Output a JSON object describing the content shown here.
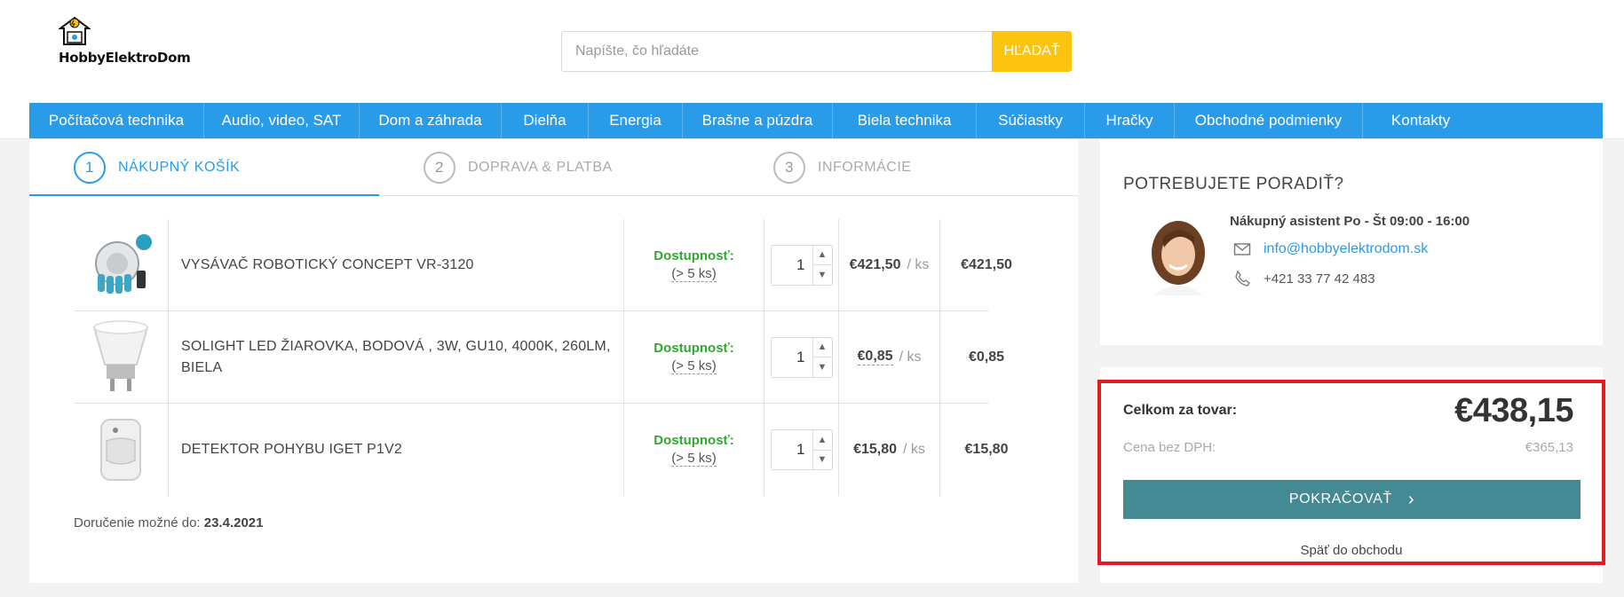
{
  "brand": {
    "name": "HobbyElektroDom",
    "accent": "#2a9be8",
    "search_button_color": "#fcc30f",
    "continue_color": "#438a95",
    "highlight_color": "#e31b23"
  },
  "search": {
    "placeholder": "Napíšte, čo hľadáte",
    "button_label": "HĽADAŤ"
  },
  "nav": [
    "Počítačová technika",
    "Audio, video, SAT",
    "Dom a záhrada",
    "Dielňa",
    "Energia",
    "Brašne a púzdra",
    "Biela technika",
    "Súčiastky",
    "Hračky",
    "Obchodné podmienky",
    "Kontakty"
  ],
  "steps": [
    {
      "num": "1",
      "label": "NÁKUPNÝ KOŠÍK",
      "active": true
    },
    {
      "num": "2",
      "label": "DOPRAVA & PLATBA",
      "active": false
    },
    {
      "num": "3",
      "label": "INFORMÁCIE",
      "active": false
    }
  ],
  "cart": {
    "availability_label": "Dostupnosť:",
    "per_unit": "/ ks",
    "items": [
      {
        "name": "VYSÁVAČ ROBOTICKÝ CONCEPT VR-3120",
        "availability": "(> 5 ks)",
        "qty": "1",
        "unit_price": "€421,50",
        "total": "€421,50",
        "image_icon": "robot-vacuum-icon"
      },
      {
        "name": "SOLIGHT LED ŽIAROVKA, BODOVÁ , 3W, GU10, 4000K, 260LM, BIELA",
        "availability": "(> 5 ks)",
        "qty": "1",
        "unit_price": "€0,85",
        "total": "€0,85",
        "image_icon": "led-bulb-icon"
      },
      {
        "name": "DETEKTOR POHYBU IGET P1V2",
        "availability": "(> 5 ks)",
        "qty": "1",
        "unit_price": "€15,80",
        "total": "€15,80",
        "image_icon": "motion-detector-icon"
      }
    ]
  },
  "delivery": {
    "label": "Doručenie možné do:",
    "date": "23.4.2021"
  },
  "help": {
    "title": "POTREBUJETE PORADIŤ?",
    "assistant": "Nákupný asistent Po - Št 09:00 - 16:00",
    "email": "info@hobbyelektrodom.sk",
    "phone": "+421 33 77 42 483"
  },
  "summary": {
    "total_label": "Celkom za tovar:",
    "total": "€438,15",
    "net_label": "Cena bez DPH:",
    "net": "€365,13",
    "continue_label": "POKRAČOVAŤ",
    "back_label": "Späť do obchodu"
  }
}
